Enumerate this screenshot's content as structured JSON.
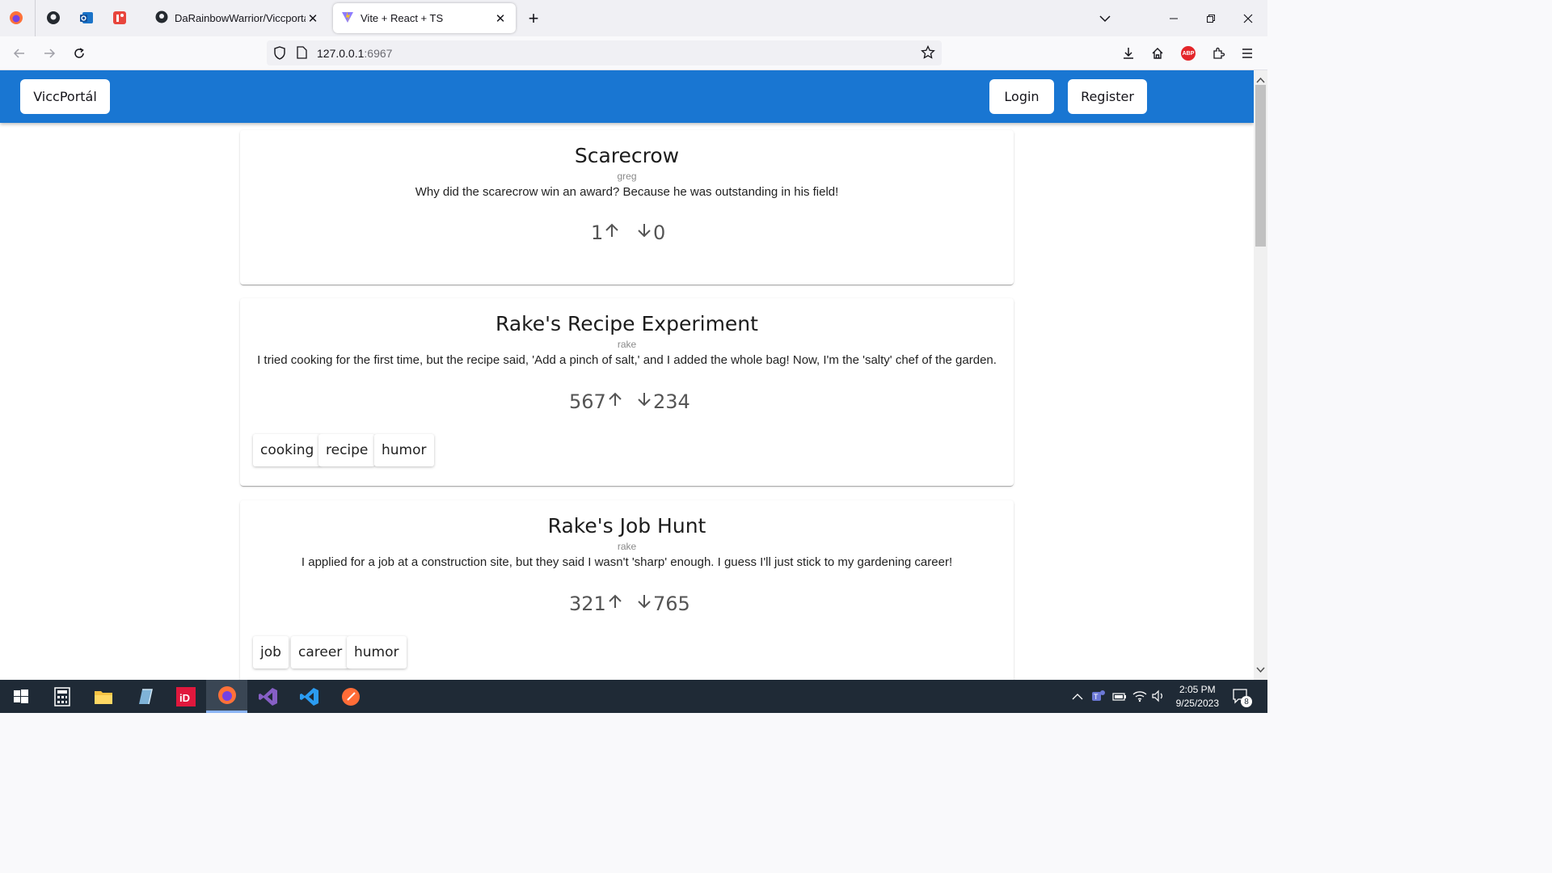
{
  "browser": {
    "tabs": [
      {
        "title": "DaRainbowWarrior/ViccportalS",
        "active": false
      },
      {
        "title": "Vite + React + TS",
        "active": true
      }
    ],
    "new_tab": "+",
    "url_host": "127.0.0.1",
    "url_port": ":6967",
    "abp_label": "ABP"
  },
  "app": {
    "brand": "ViccPortál",
    "login_label": "Login",
    "register_label": "Register",
    "accent_color": "#1976d2"
  },
  "jokes": [
    {
      "title": "Scarecrow",
      "author": "greg",
      "text": "Why did the scarecrow win an award? Because he was outstanding in his field!",
      "upvotes": "1",
      "downvotes": "0",
      "tags": []
    },
    {
      "title": "Rake's Recipe Experiment",
      "author": "rake",
      "text": "I tried cooking for the first time, but the recipe said, 'Add a pinch of salt,' and I added the whole bag! Now, I'm the 'salty' chef of the garden.",
      "upvotes": "567",
      "downvotes": "234",
      "tags": [
        "cooking",
        "recipe",
        "humor"
      ]
    },
    {
      "title": "Rake's Job Hunt",
      "author": "rake",
      "text": "I applied for a job at a construction site, but they said I wasn't 'sharp' enough. I guess I'll just stick to my gardening career!",
      "upvotes": "321",
      "downvotes": "765",
      "tags": [
        "job",
        "career",
        "humor"
      ]
    }
  ],
  "taskbar": {
    "time": "2:05 PM",
    "date": "9/25/2023",
    "notification_count": "8"
  }
}
